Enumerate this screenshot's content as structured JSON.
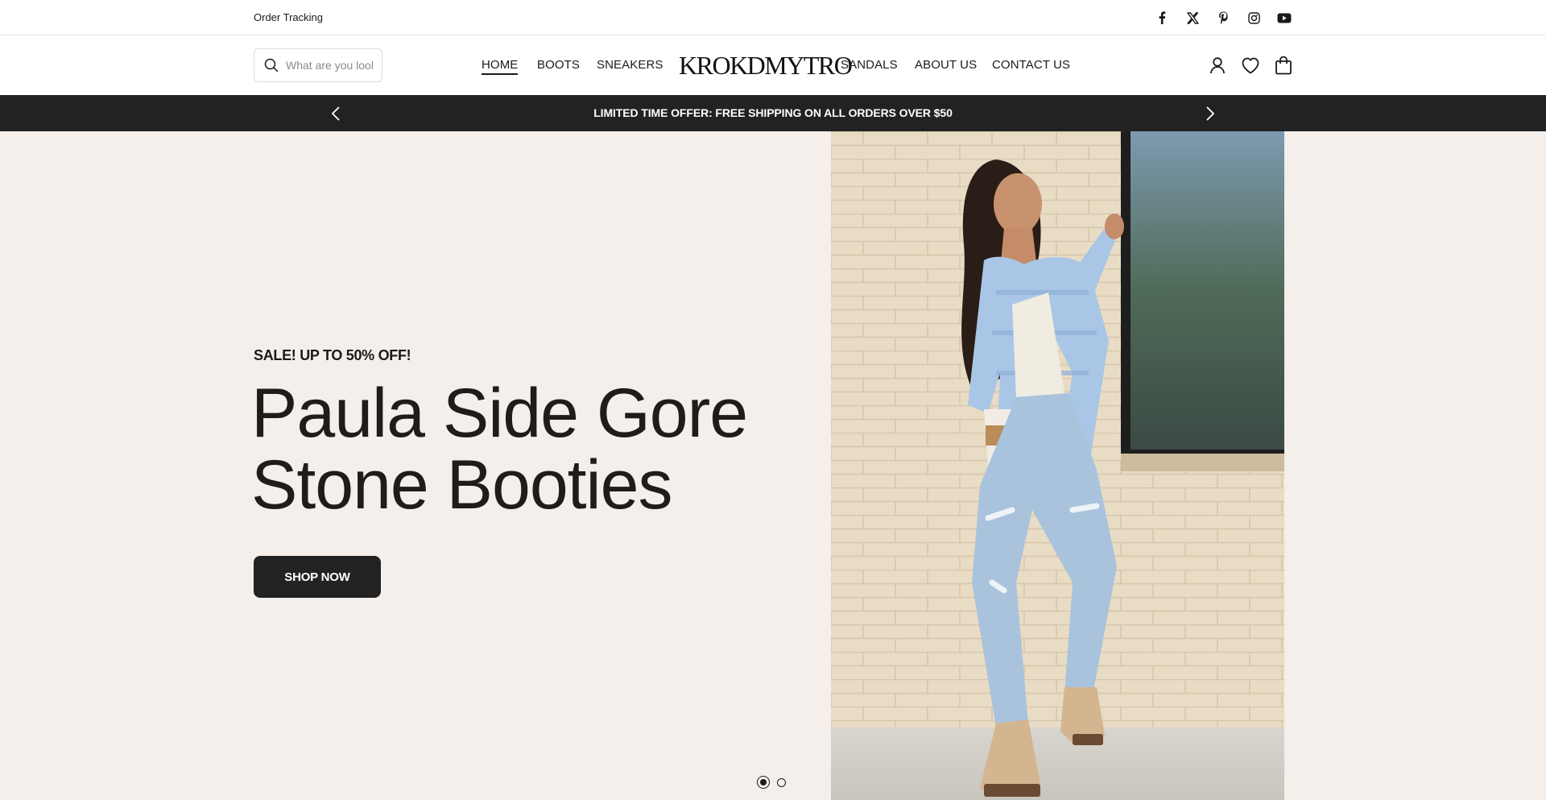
{
  "topbar": {
    "order_tracking": "Order Tracking",
    "socials": [
      "facebook-icon",
      "x-icon",
      "pinterest-icon",
      "instagram-icon",
      "youtube-icon"
    ]
  },
  "header": {
    "search_placeholder": "What are you looking for?",
    "logo": "KROKDMYTRO",
    "nav_left": [
      "HOME",
      "BOOTS",
      "SNEAKERS"
    ],
    "nav_right": [
      "SANDALS",
      "ABOUT US",
      "CONTACT US"
    ],
    "active_nav": "HOME",
    "icons": [
      "account-icon",
      "wishlist-heart-icon",
      "shopping-bag-icon"
    ]
  },
  "announcement": {
    "text": "LIMITED TIME OFFER: FREE SHIPPING ON ALL ORDERS OVER $50"
  },
  "hero": {
    "eyebrow": "SALE! UP TO 50% OFF!",
    "headline_line1": "Paula Side Gore",
    "headline_line2": "Stone Booties",
    "button": "SHOP NOW",
    "slides_total": 2,
    "active_slide": 1
  },
  "colors": {
    "hero_bg": "#f4efeb",
    "announce_bg": "#222222",
    "button_bg": "#222222",
    "text": "#1a1a1a"
  }
}
